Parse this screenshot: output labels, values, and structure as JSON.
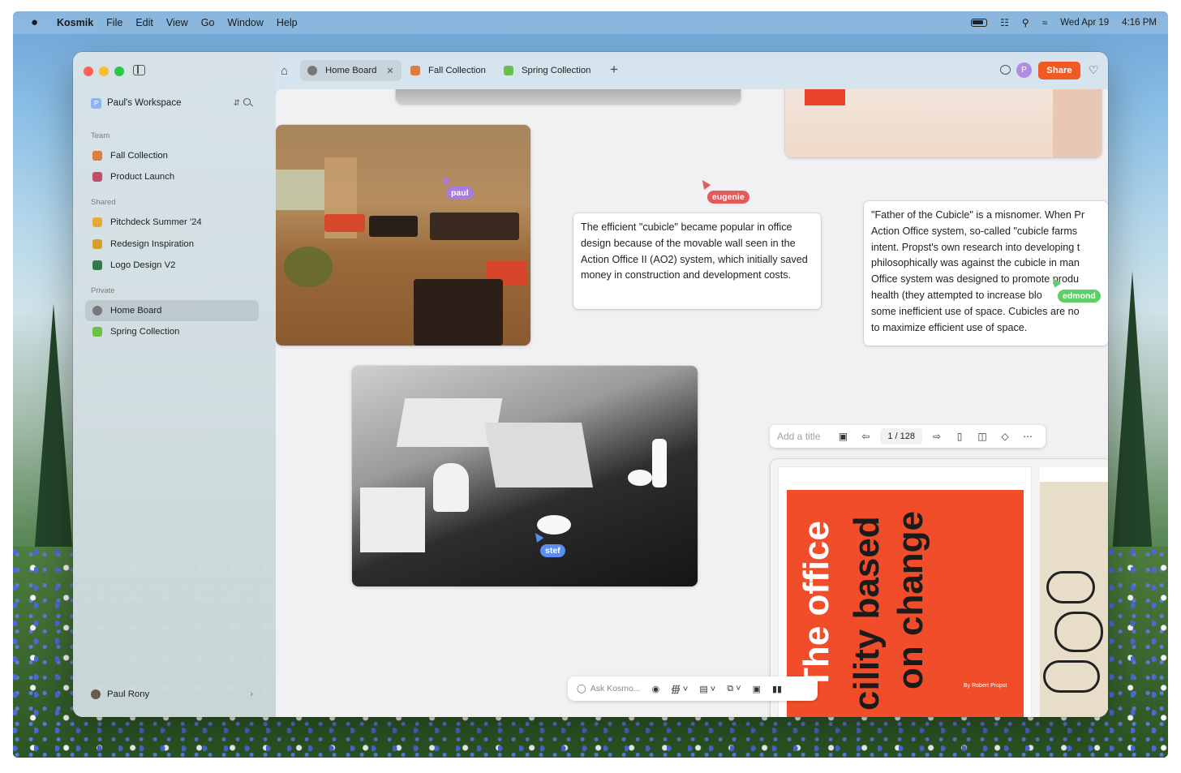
{
  "menubar": {
    "app_name": "Kosmik",
    "menus": [
      "File",
      "Edit",
      "View",
      "Go",
      "Window",
      "Help"
    ],
    "date": "Wed Apr 19",
    "time": "4:16 PM"
  },
  "sidebar": {
    "workspace": {
      "badge": "P",
      "name": "Paul's Workspace"
    },
    "sections": [
      {
        "label": "Team",
        "items": [
          {
            "label": "Fall Collection",
            "icon": "leaf-icon",
            "color": "#e07b39"
          },
          {
            "label": "Product Launch",
            "icon": "building-icon",
            "color": "#c0506a"
          }
        ]
      },
      {
        "label": "Shared",
        "items": [
          {
            "label": "Pitchdeck Summer '24",
            "icon": "chart-icon",
            "color": "#e8a93b"
          },
          {
            "label": "Redesign Inspiration",
            "icon": "pencil-icon",
            "color": "#d4a02a"
          },
          {
            "label": "Logo Design V2",
            "icon": "book-icon",
            "color": "#2f7a4a"
          }
        ]
      },
      {
        "label": "Private",
        "items": [
          {
            "label": "Home Board",
            "icon": "home-board-icon",
            "color": "#666666",
            "active": true
          },
          {
            "label": "Spring Collection",
            "icon": "sprout-icon",
            "color": "#6abf4b"
          }
        ]
      }
    ],
    "user": {
      "name": "Paul Rony"
    }
  },
  "tabs": [
    {
      "label": "Home Board",
      "active": true,
      "color": "#666666"
    },
    {
      "label": "Fall Collection",
      "active": false,
      "color": "#e07b39"
    },
    {
      "label": "Spring Collection",
      "active": false,
      "color": "#6abf4b"
    }
  ],
  "toolbar": {
    "avatar_initial": "P",
    "share_label": "Share",
    "accent": "#f05a23"
  },
  "canvas": {
    "note_1": "The efficient \"cubicle\" became popular in office design because of the movable wall seen in the Action Office II (AO2) system, which initially saved money in construction and development costs.",
    "note_2_lines": [
      "\"Father of the Cubicle\" is a misnomer. When Pr",
      "Action Office system, so-called \"cubicle farms",
      "intent. Propst's own research into developing t",
      "philosophically was against the cubicle in man",
      "Office system was designed to promote produ",
      "health (they attempted to increase blo",
      "some inefficient use of space. Cubicles are no",
      "to maximize efficient use of space."
    ],
    "cursors": [
      {
        "name": "paul",
        "color": "#a77be0"
      },
      {
        "name": "eugenie",
        "color": "#e35a5a"
      },
      {
        "name": "edmond",
        "color": "#5fcf6a"
      },
      {
        "name": "stef",
        "color": "#5b8cf0"
      }
    ],
    "doc_toolbar": {
      "title_placeholder": "Add a title",
      "page": "1 / 128"
    },
    "poster": {
      "line1": "The office",
      "line2": "cility based",
      "line3": "on change",
      "byline": "By Robert Propst"
    },
    "bottom_bar": {
      "placeholder": "Ask Kosmo..."
    }
  }
}
